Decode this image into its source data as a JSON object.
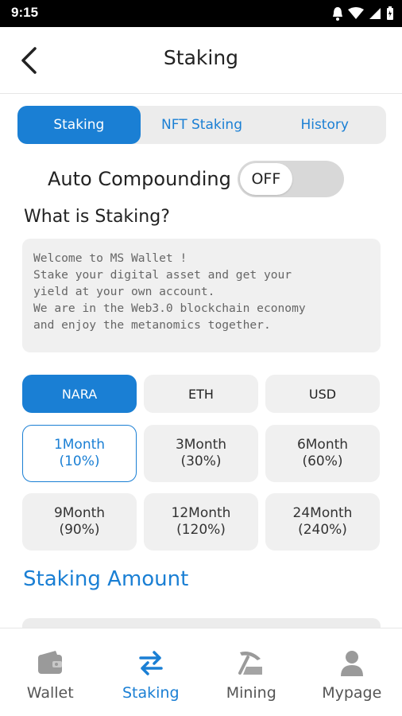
{
  "status_bar": {
    "time": "9:15"
  },
  "header": {
    "title": "Staking"
  },
  "tabs": [
    {
      "label": "Staking",
      "active": true
    },
    {
      "label": "NFT Staking",
      "active": false
    },
    {
      "label": "History",
      "active": false
    }
  ],
  "auto_compounding": {
    "label": "Auto Compounding",
    "toggle_text": "OFF"
  },
  "what_is": {
    "title": "What is Staking?",
    "text": "Welcome to MS Wallet !\nStake your digital asset and get your\nyield at your own account.\nWe are in the Web3.0 blockchain economy\nand enjoy the metanomics together."
  },
  "currencies": [
    {
      "label": "NARA",
      "active": true
    },
    {
      "label": "ETH",
      "active": false
    },
    {
      "label": "USD",
      "active": false
    }
  ],
  "periods": [
    {
      "duration": "1Month",
      "rate": "(10%)",
      "active": true
    },
    {
      "duration": "3Month",
      "rate": "(30%)",
      "active": false
    },
    {
      "duration": "6Month",
      "rate": "(60%)",
      "active": false
    },
    {
      "duration": "9Month",
      "rate": "(90%)",
      "active": false
    },
    {
      "duration": "12Month",
      "rate": "(120%)",
      "active": false
    },
    {
      "duration": "24Month",
      "rate": "(240%)",
      "active": false
    }
  ],
  "staking_amount": {
    "title": "Staking Amount"
  },
  "bottom_nav": [
    {
      "label": "Wallet",
      "icon": "wallet-icon",
      "active": false
    },
    {
      "label": "Staking",
      "icon": "swap-arrows-icon",
      "active": true
    },
    {
      "label": "Mining",
      "icon": "pickaxe-icon",
      "active": false
    },
    {
      "label": "Mypage",
      "icon": "person-icon",
      "active": false
    }
  ],
  "colors": {
    "accent": "#1a7fd4",
    "inactive_bg": "#f0f0f0",
    "nav_inactive": "#9a9a9a"
  }
}
